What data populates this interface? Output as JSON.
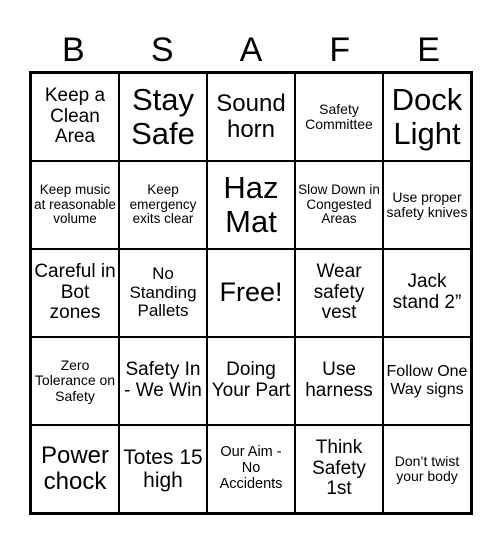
{
  "card": {
    "header": [
      "B",
      "S",
      "A",
      "F",
      "E"
    ],
    "cells": [
      [
        "Keep a Clean Area",
        "Stay Safe",
        "Sound horn",
        "Safety Committee",
        "Dock Light"
      ],
      [
        "Keep music at reasonable volume",
        "Keep emergency exits clear",
        "Haz Mat",
        "Slow Down in Congested Areas",
        "Use proper safety knives"
      ],
      [
        "Careful in Bot zones",
        "No Standing Pallets",
        "Free!",
        "Wear safety vest",
        "Jack stand 2”"
      ],
      [
        "Zero Tolerance on Safety",
        "Safety In - We Win",
        "Doing Your Part",
        "Use harness",
        "Follow One Way signs"
      ],
      [
        "Power chock",
        "Totes 15 high",
        "Our Aim - No Accidents",
        "Think Safety 1st",
        "Don’t twist your body"
      ]
    ],
    "free_space": {
      "row": 2,
      "col": 2
    }
  }
}
